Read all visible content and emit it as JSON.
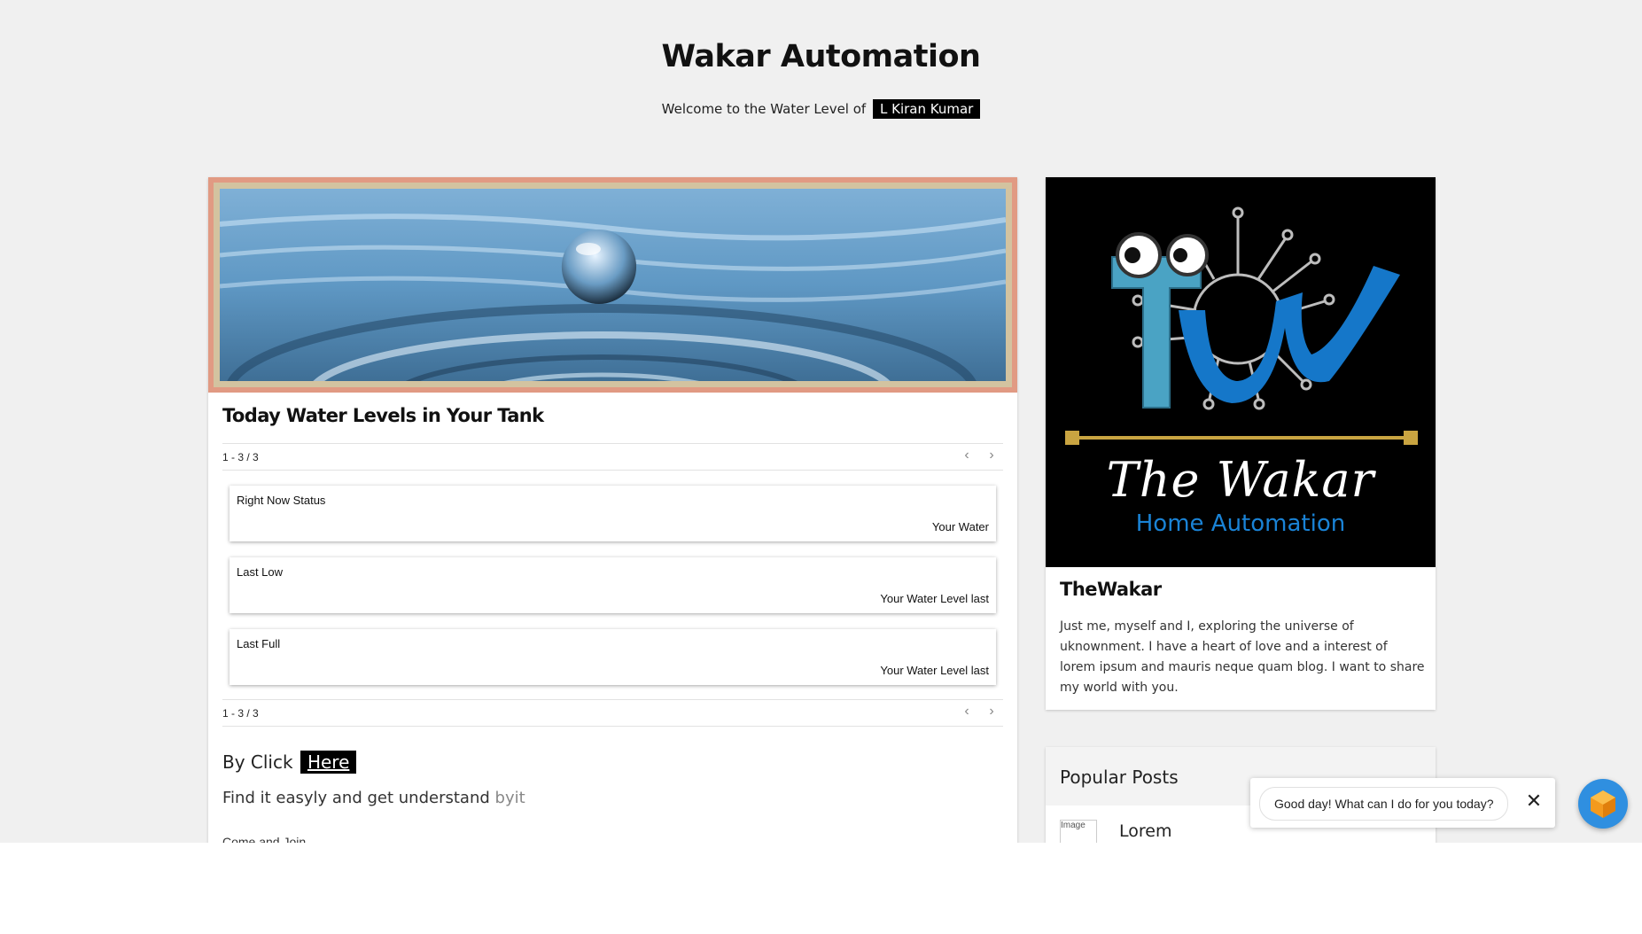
{
  "header": {
    "site_title": "Wakar Automation",
    "welcome_text": "Welcome to the Water Level of",
    "user_name": "L Kiran Kumar"
  },
  "main": {
    "card_title": "Today Water Levels in Your Tank",
    "pager_count_top": "1 - 3 / 3",
    "pager_count_bottom": "1 - 3 / 3",
    "status_items": [
      {
        "title": "Right Now Status",
        "value": "Your Water"
      },
      {
        "title": "Last Low",
        "value": "Your Water Level last"
      },
      {
        "title": "Last Full",
        "value": "Your Water Level last"
      }
    ],
    "by_click_text": "By Click",
    "here_link": "Here",
    "find_text": "Find it easyly and get understand",
    "find_text_grey": "byit",
    "come_join": "Come and Join"
  },
  "profile": {
    "logo_script": "The Wakar",
    "logo_sub": "Home Automation",
    "name": "TheWakar",
    "bio": "Just me, myself and I, exploring the universe of uknownment. I have a heart of love and a interest of lorem ipsum and mauris neque quam blog. I want to share my world with you."
  },
  "popular": {
    "title": "Popular Posts",
    "post_thumb_alt": "Image",
    "post_title": "Lorem"
  },
  "chat": {
    "greeting": "Good day! What can I do for you today?",
    "close_glyph": "✕"
  },
  "icons": {
    "prev": "‹",
    "next": "›"
  },
  "colors": {
    "page_bg": "#f0f0f0",
    "hero_frame": "#e19a83",
    "logo_blue": "#1a83d6",
    "chat_launcher": "#2f8fe0"
  }
}
